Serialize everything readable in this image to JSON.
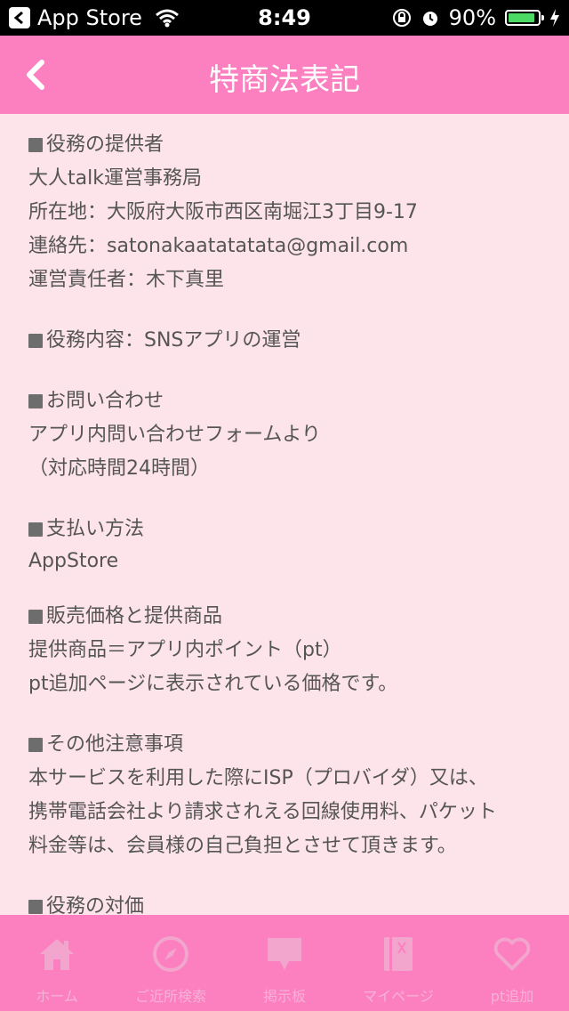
{
  "status_bar": {
    "carrier": "App Store",
    "time": "8:49",
    "battery_percent": "90%",
    "battery_level": 0.9,
    "icons": [
      "wifi-icon",
      "rotation-lock-icon",
      "alarm-icon",
      "battery-icon",
      "charging-bolt-icon"
    ]
  },
  "nav": {
    "title": "特商法表記",
    "back_icon": "chevron-left-icon"
  },
  "colors": {
    "nav_bg": "#fc7fc0",
    "content_bg": "#fde3ea",
    "text": "#555555",
    "bullet": "#6d6d6d"
  },
  "sections": [
    {
      "heading": "役務の提供者",
      "lines": [
        "大人talk運営事務局",
        "所在地：大阪府大阪市西区南堀江3丁目9-17",
        "連絡先：satonakaatatatata@gmail.com",
        "運営責任者：木下真里"
      ]
    },
    {
      "heading": "役務内容：SNSアプリの運営",
      "lines": []
    },
    {
      "heading": "お問い合わせ",
      "lines": [
        "アプリ内問い合わせフォームより",
        "（対応時間24時間）"
      ]
    },
    {
      "heading": "支払い方法",
      "lines": [
        "AppStore"
      ]
    },
    {
      "heading": "販売価格と提供商品",
      "lines": [
        "提供商品＝アプリ内ポイント（pt）",
        "pt追加ページに表示されている価格です。"
      ]
    },
    {
      "heading": "その他注意事項",
      "lines": [
        "本サービスを利用した際にISP（プロバイダ）又は、",
        "携帯電話会社より請求されえる回線使用料、パケット",
        "料金等は、会員様の自己負担とさせて頂きます。"
      ]
    },
    {
      "heading": "役務の対価",
      "lines": []
    }
  ],
  "tabs": [
    {
      "label": "ホーム",
      "icon": "home-icon"
    },
    {
      "label": "ご近所検索",
      "icon": "compass-icon"
    },
    {
      "label": "掲示板",
      "icon": "speech-bubble-icon"
    },
    {
      "label": "マイページ",
      "icon": "notebook-icon"
    },
    {
      "label": "pt追加",
      "icon": "heart-icon"
    }
  ]
}
